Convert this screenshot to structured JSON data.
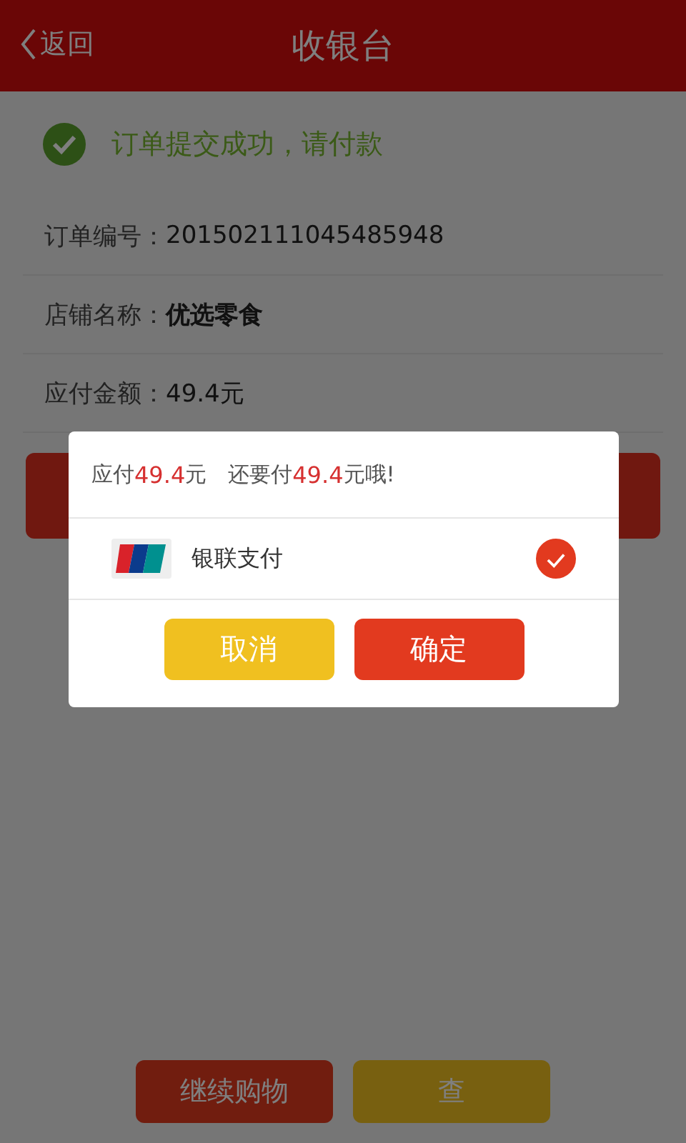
{
  "header": {
    "back_label": "返回",
    "title": "收银台"
  },
  "status": {
    "message": "订单提交成功，请付款"
  },
  "order_fields": [
    {
      "label": "订单编号：",
      "value": "201502111045485948",
      "bold": false
    },
    {
      "label": "店铺名称：",
      "value": "优选零食",
      "bold": true
    },
    {
      "label": "应付金额：",
      "value": "49.4元",
      "bold": false
    }
  ],
  "bottom_buttons": [
    {
      "label": "继续购物",
      "kind": "primary"
    },
    {
      "label": "查",
      "kind": "secondary"
    }
  ],
  "dialog": {
    "summary": [
      {
        "text": "应付",
        "kind": "plain"
      },
      {
        "text": "49.4",
        "kind": "amount"
      },
      {
        "text": "元",
        "kind": "plain"
      },
      {
        "text": "还要付",
        "kind": "plain"
      },
      {
        "text": "49.4",
        "kind": "amount"
      },
      {
        "text": "元哦!",
        "kind": "plain"
      }
    ],
    "methods": [
      {
        "name": "银联支付",
        "selected": true
      }
    ],
    "buttons": [
      {
        "label": "取消",
        "kind": "secondary"
      },
      {
        "label": "确定",
        "kind": "primary"
      }
    ]
  }
}
